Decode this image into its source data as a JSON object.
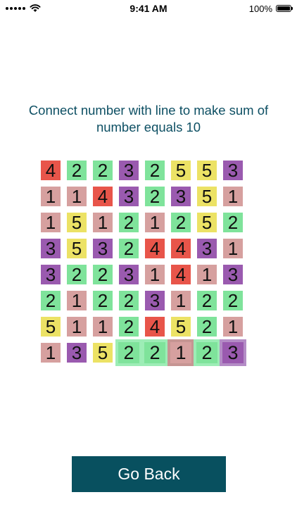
{
  "status_bar": {
    "time": "9:41 AM",
    "battery_text": "100%",
    "battery_level": 1.0
  },
  "instruction": "Connect number with line to make sum of number equals 10",
  "colors": {
    "1": "#d6a09f",
    "2": "#7fe39b",
    "3": "#9a5aaf",
    "4": "#e8554a",
    "5": "#ece265",
    "selected_1_border": "#c69593",
    "selected_2_border": "#9dedb6",
    "selected_3_border": "#b48cc6",
    "connector": "#b9c0bd",
    "button": "#08505f",
    "instruction_text": "#0d4f63"
  },
  "grid": [
    [
      "4",
      "2",
      "2",
      "3",
      "2",
      "5",
      "5",
      "3"
    ],
    [
      "1",
      "1",
      "4",
      "3",
      "2",
      "3",
      "5",
      "1"
    ],
    [
      "1",
      "5",
      "1",
      "2",
      "1",
      "2",
      "5",
      "2"
    ],
    [
      "3",
      "5",
      "3",
      "2",
      "4",
      "4",
      "3",
      "1"
    ],
    [
      "3",
      "2",
      "2",
      "3",
      "1",
      "4",
      "1",
      "3"
    ],
    [
      "2",
      "1",
      "2",
      "2",
      "3",
      "1",
      "2",
      "2"
    ],
    [
      "5",
      "1",
      "1",
      "2",
      "4",
      "5",
      "2",
      "1"
    ],
    [
      "1",
      "3",
      "5",
      "2",
      "2",
      "1",
      "2",
      "3"
    ]
  ],
  "selected_path": [
    [
      7,
      3
    ],
    [
      7,
      4
    ],
    [
      7,
      5
    ],
    [
      7,
      6
    ],
    [
      7,
      7
    ]
  ],
  "go_back_label": "Go Back"
}
